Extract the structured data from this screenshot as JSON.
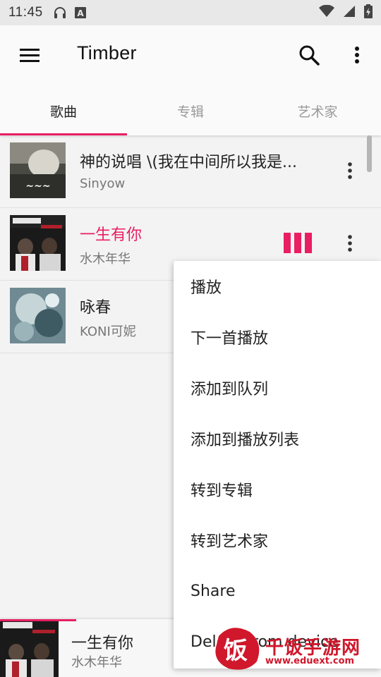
{
  "status_bar": {
    "time": "11:45",
    "icons": [
      "headphones-icon",
      "a-notification-icon",
      "wifi-icon",
      "signal-icon",
      "battery-icon"
    ]
  },
  "app_bar": {
    "title": "Timber",
    "icons": [
      "menu-icon",
      "search-icon",
      "more-vert-icon"
    ]
  },
  "tabs": [
    {
      "label": "歌曲",
      "active": true
    },
    {
      "label": "专辑",
      "active": false
    },
    {
      "label": "艺术家",
      "active": false
    }
  ],
  "songs": [
    {
      "title": "神的说唱 \\(我在中间所以我是...",
      "artist": "Sinyow",
      "playing": false
    },
    {
      "title": "一生有你",
      "artist": "水木年华",
      "playing": true
    },
    {
      "title": "咏春",
      "artist": "KONI可妮",
      "playing": false
    }
  ],
  "context_menu": {
    "items": [
      "播放",
      "下一首播放",
      "添加到队列",
      "添加到播放列表",
      "转到专辑",
      "转到艺术家",
      "Share",
      "Delete from device"
    ]
  },
  "mini_player": {
    "title": "一生有你",
    "artist": "水木年华",
    "progress": 0.2
  },
  "watermark": {
    "text": "千饭手游网",
    "url": "www.eduext.com"
  },
  "colors": {
    "accent": "#e91e63",
    "watermark": "#d0172b"
  }
}
